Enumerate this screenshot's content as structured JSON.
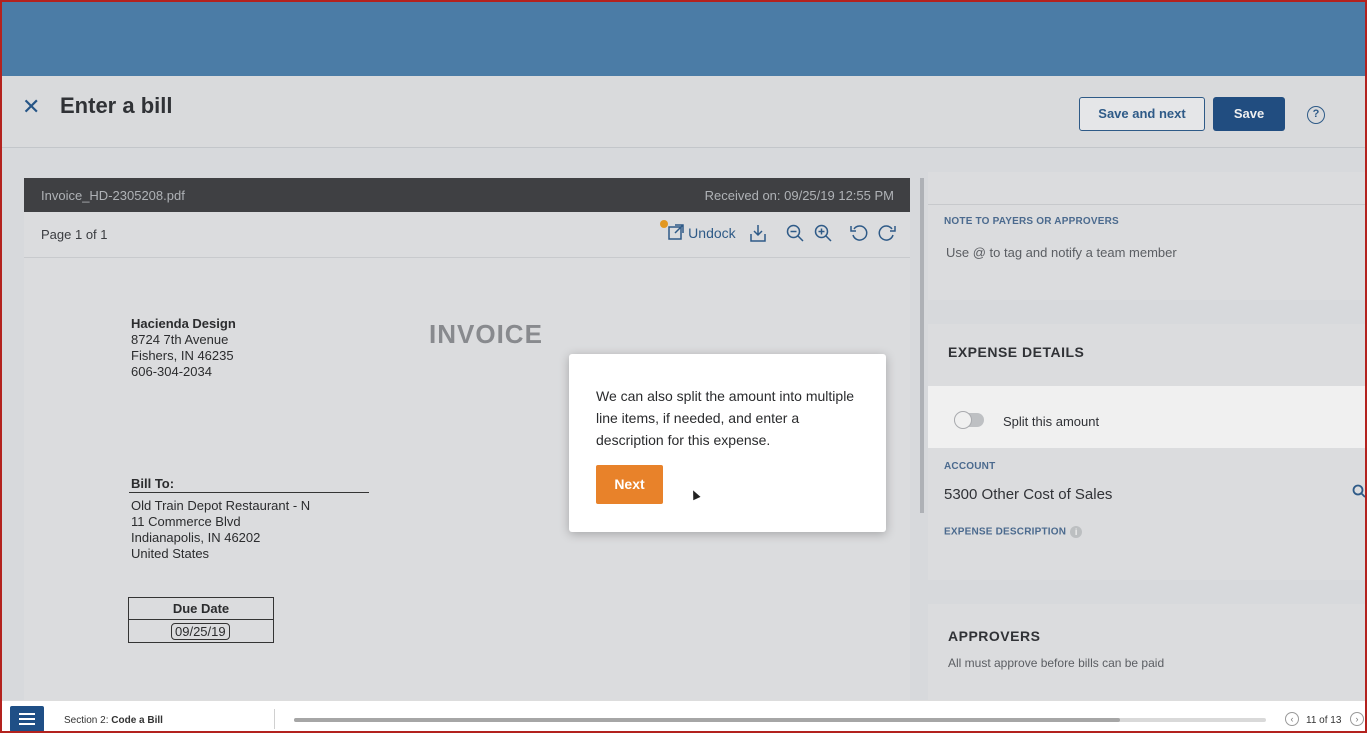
{
  "header": {
    "title": "Enter a bill",
    "save_next_label": "Save and next",
    "save_label": "Save",
    "close_glyph": "✕",
    "help_glyph": "?"
  },
  "viewer": {
    "filename": "Invoice_HD-2305208.pdf",
    "received": "Received on: 09/25/19 12:55 PM",
    "page_count": "Page 1 of 1",
    "undock_label": "Undock",
    "icons": [
      "undock-icon",
      "download-icon",
      "zoom-out-icon",
      "zoom-in-icon",
      "rotate-left-icon",
      "rotate-right-icon"
    ]
  },
  "invoice": {
    "title": "INVOICE",
    "company_name": "Hacienda Design",
    "company_address1": "8724 7th Avenue",
    "company_address2": "Fishers, IN 46235",
    "company_phone": "606-304-2034",
    "bill_to_label": "Bill To:",
    "bill_to_name": "Old Train Depot Restaurant - N",
    "bill_to_address1": "11 Commerce Blvd",
    "bill_to_address2": "Indianapolis, IN 46202",
    "bill_to_country": "United States",
    "due_date_label": "Due Date",
    "due_date_value": "09/25/19"
  },
  "right_panel": {
    "note_label": "NOTE TO PAYERS OR APPROVERS",
    "note_placeholder": "Use @ to tag and notify a team member",
    "expense_title": "EXPENSE DETAILS",
    "split_label": "Split this amount",
    "split_enabled": false,
    "account_label": "ACCOUNT",
    "account_value": "5300 Other Cost of Sales",
    "description_label": "EXPENSE DESCRIPTION",
    "approvers_title": "APPROVERS",
    "approvers_hint": "All must approve before bills can be paid"
  },
  "popup": {
    "message": "We can also split the amount into multiple line items, if needed, and enter a description for this expense.",
    "next_label": "Next"
  },
  "bottom": {
    "section_prefix": "Section 2: ",
    "section_name": "Code a Bill",
    "pager": "11 of 13",
    "progress": 0.85
  },
  "colors": {
    "topbar": "#4b7ca6",
    "brand_blue": "#1f4f86",
    "accent_orange": "#e8822a",
    "frame_border": "#b3221e"
  }
}
